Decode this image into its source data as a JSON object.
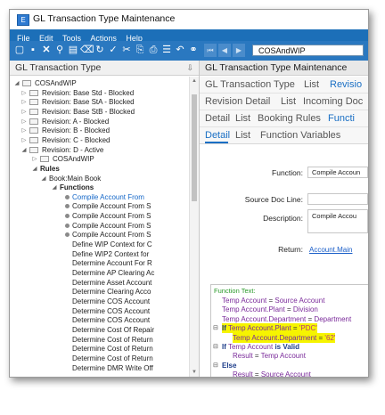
{
  "window": {
    "title": "GL Transaction Type Maintenance"
  },
  "menu": [
    "File",
    "Edit",
    "Tools",
    "Actions",
    "Help"
  ],
  "toolbar": {
    "search_value": "COSAndWIP"
  },
  "left_pane": {
    "header": "GL Transaction Type",
    "tree": [
      {
        "label": "COSAndWIP",
        "level": 0,
        "toggle": "◢",
        "kind": "node"
      },
      {
        "label": "Revision: Base Std - Blocked",
        "level": 1,
        "toggle": "▷",
        "kind": "node"
      },
      {
        "label": "Revision: Base StA - Blocked",
        "level": 1,
        "toggle": "▷",
        "kind": "node"
      },
      {
        "label": "Revision: Base StB - Blocked",
        "level": 1,
        "toggle": "▷",
        "kind": "node"
      },
      {
        "label": "Revision: A - Blocked",
        "level": 1,
        "toggle": "▷",
        "kind": "node"
      },
      {
        "label": "Revision: B - Blocked",
        "level": 1,
        "toggle": "▷",
        "kind": "node"
      },
      {
        "label": "Revision: C - Blocked",
        "level": 1,
        "toggle": "▷",
        "kind": "node"
      },
      {
        "label": "Revision: D - Active",
        "level": 1,
        "toggle": "◢",
        "kind": "node"
      },
      {
        "label": "COSAndWIP",
        "level": 2,
        "toggle": "▷",
        "kind": "node"
      },
      {
        "label": "Rules",
        "level": 2,
        "toggle": "◢",
        "kind": "bold"
      },
      {
        "label": "Book:Main Book",
        "level": 3,
        "toggle": "◢",
        "kind": "plain"
      },
      {
        "label": "Functions",
        "level": 4,
        "toggle": "◢",
        "kind": "bold"
      },
      {
        "label": "Compile Account From",
        "level": 5,
        "toggle": "",
        "kind": "sel"
      },
      {
        "label": "Compile Account From S",
        "level": 5,
        "toggle": "",
        "kind": "bullet"
      },
      {
        "label": "Compile Account From S",
        "level": 5,
        "toggle": "",
        "kind": "bullet"
      },
      {
        "label": "Compile Account From S",
        "level": 5,
        "toggle": "",
        "kind": "bullet"
      },
      {
        "label": "Compile Account From S",
        "level": 5,
        "toggle": "",
        "kind": "bullet"
      },
      {
        "label": "Define WIP Context for C",
        "level": 5,
        "toggle": "",
        "kind": "leaf"
      },
      {
        "label": "Define WIP2 Context for",
        "level": 5,
        "toggle": "",
        "kind": "leaf"
      },
      {
        "label": "Determine Account For R",
        "level": 5,
        "toggle": "",
        "kind": "leaf"
      },
      {
        "label": "Determine AP Clearing Ac",
        "level": 5,
        "toggle": "",
        "kind": "leaf"
      },
      {
        "label": "Determine Asset Account",
        "level": 5,
        "toggle": "",
        "kind": "leaf"
      },
      {
        "label": "Determine Clearing Acco",
        "level": 5,
        "toggle": "",
        "kind": "leaf"
      },
      {
        "label": "Determine COS Account",
        "level": 5,
        "toggle": "",
        "kind": "leaf"
      },
      {
        "label": "Determine COS Account",
        "level": 5,
        "toggle": "",
        "kind": "leaf"
      },
      {
        "label": "Determine COS Account",
        "level": 5,
        "toggle": "",
        "kind": "leaf"
      },
      {
        "label": "Determine Cost Of Repair",
        "level": 5,
        "toggle": "",
        "kind": "leaf"
      },
      {
        "label": "Determine Cost of Return",
        "level": 5,
        "toggle": "",
        "kind": "leaf"
      },
      {
        "label": "Determine Cost of Return",
        "level": 5,
        "toggle": "",
        "kind": "leaf"
      },
      {
        "label": "Determine Cost of Return",
        "level": 5,
        "toggle": "",
        "kind": "leaf"
      },
      {
        "label": "Determine DMR Write Off",
        "level": 5,
        "toggle": "",
        "kind": "leaf"
      }
    ]
  },
  "right_pane": {
    "header": "GL Transaction Type Maintenance",
    "tabs1": [
      "GL Transaction Type",
      "List",
      "Revisio"
    ],
    "tabs2": [
      "Revision Detail",
      "List",
      "Incoming Doc"
    ],
    "tabs3": [
      "Detail",
      "List",
      "Booking Rules",
      "Functi"
    ],
    "tabs4": [
      "Detail",
      "List",
      "Function Variables"
    ],
    "form": {
      "function_label": "Function:",
      "function_value": "Compile Accoun",
      "source_doc_label": "Source Doc Line:",
      "source_doc_value": "",
      "description_label": "Description:",
      "description_value": "Compile Accou",
      "return_label": "Return:",
      "return_value": "Account.Main"
    },
    "code": {
      "title": "Function Text:",
      "lines": [
        {
          "gutter": "",
          "indent": 0,
          "kind": "assign",
          "left": "Temp Account",
          "op": "=",
          "right": "Source Account",
          "right_kind": "vr",
          "hl": false
        },
        {
          "gutter": "",
          "indent": 0,
          "kind": "assign",
          "left": "Temp Account.Plant",
          "op": "=",
          "right": "Division",
          "right_kind": "vr",
          "hl": false
        },
        {
          "gutter": "",
          "indent": 0,
          "kind": "assign",
          "left": "Temp Account.Department",
          "op": "=",
          "right": "Department",
          "right_kind": "vr",
          "hl": false
        },
        {
          "gutter": "⊟",
          "indent": 0,
          "kind": "if",
          "kw": "If",
          "left": "Temp Account.Plant",
          "op": "=",
          "right": "'PDC'",
          "right_kind": "st",
          "hl": true
        },
        {
          "gutter": "",
          "indent": 1,
          "kind": "assign",
          "left": "Temp Account.Department",
          "op": "=",
          "right": "'62'",
          "right_kind": "st",
          "hl": true
        },
        {
          "gutter": "⊟",
          "indent": 0,
          "kind": "if",
          "kw": "If",
          "left": "Temp Account",
          "op": "is Valid",
          "right": "",
          "right_kind": "vr",
          "hl": false
        },
        {
          "gutter": "",
          "indent": 1,
          "kind": "assign",
          "left": "Result",
          "op": "=",
          "right": "Temp Account",
          "right_kind": "vr",
          "hl": false
        },
        {
          "gutter": "⊟",
          "indent": 0,
          "kind": "else",
          "kw": "Else",
          "left": "",
          "op": "",
          "right": "",
          "right_kind": "vr",
          "hl": false
        },
        {
          "gutter": "",
          "indent": 1,
          "kind": "assign",
          "left": "Result",
          "op": "=",
          "right": "Source Account",
          "right_kind": "vr",
          "hl": false
        }
      ]
    }
  }
}
